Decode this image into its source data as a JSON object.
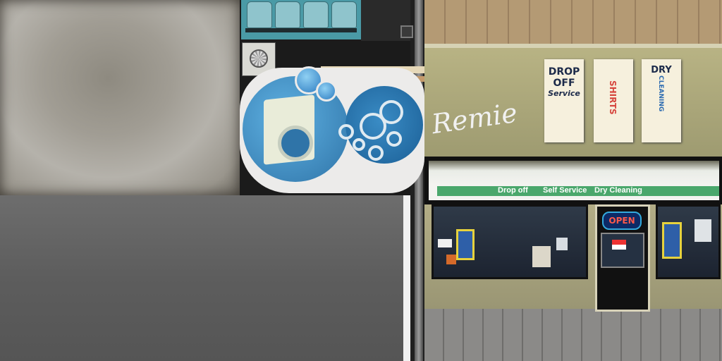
{
  "atlas": {
    "logo": {
      "washer_color": "#2f74a8",
      "bubble_color": "#1b5f96"
    },
    "storefront": {
      "graffiti": "Remie",
      "posters": [
        {
          "lines": [
            "DROP",
            "OFF",
            "Service"
          ],
          "color": "#1c2a4a"
        },
        {
          "lines": [
            "SHIRTS"
          ],
          "color": "#d6453d"
        },
        {
          "lines": [
            "DRY",
            "CLEANING"
          ],
          "color": "#2b6ab0"
        }
      ],
      "awning_labels": [
        "Drop off",
        "Self Service",
        "Dry Cleaning"
      ],
      "open_sign": "OPEN",
      "awning_color": "#4aa76c"
    }
  }
}
